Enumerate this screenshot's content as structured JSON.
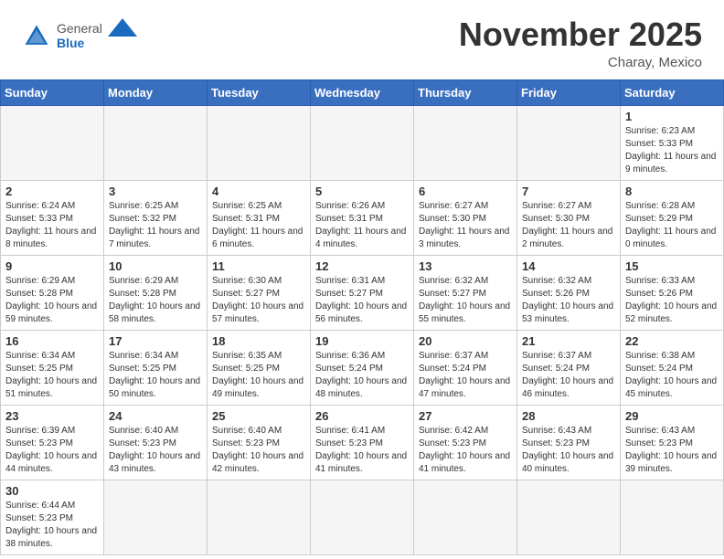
{
  "header": {
    "logo_general": "General",
    "logo_blue": "Blue",
    "month_title": "November 2025",
    "subtitle": "Charay, Mexico"
  },
  "weekdays": [
    "Sunday",
    "Monday",
    "Tuesday",
    "Wednesday",
    "Thursday",
    "Friday",
    "Saturday"
  ],
  "days": {
    "1": {
      "sunrise": "6:23 AM",
      "sunset": "5:33 PM",
      "daylight": "11 hours and 9 minutes."
    },
    "2": {
      "sunrise": "6:24 AM",
      "sunset": "5:33 PM",
      "daylight": "11 hours and 8 minutes."
    },
    "3": {
      "sunrise": "6:25 AM",
      "sunset": "5:32 PM",
      "daylight": "11 hours and 7 minutes."
    },
    "4": {
      "sunrise": "6:25 AM",
      "sunset": "5:31 PM",
      "daylight": "11 hours and 6 minutes."
    },
    "5": {
      "sunrise": "6:26 AM",
      "sunset": "5:31 PM",
      "daylight": "11 hours and 4 minutes."
    },
    "6": {
      "sunrise": "6:27 AM",
      "sunset": "5:30 PM",
      "daylight": "11 hours and 3 minutes."
    },
    "7": {
      "sunrise": "6:27 AM",
      "sunset": "5:30 PM",
      "daylight": "11 hours and 2 minutes."
    },
    "8": {
      "sunrise": "6:28 AM",
      "sunset": "5:29 PM",
      "daylight": "11 hours and 0 minutes."
    },
    "9": {
      "sunrise": "6:29 AM",
      "sunset": "5:28 PM",
      "daylight": "10 hours and 59 minutes."
    },
    "10": {
      "sunrise": "6:29 AM",
      "sunset": "5:28 PM",
      "daylight": "10 hours and 58 minutes."
    },
    "11": {
      "sunrise": "6:30 AM",
      "sunset": "5:27 PM",
      "daylight": "10 hours and 57 minutes."
    },
    "12": {
      "sunrise": "6:31 AM",
      "sunset": "5:27 PM",
      "daylight": "10 hours and 56 minutes."
    },
    "13": {
      "sunrise": "6:32 AM",
      "sunset": "5:27 PM",
      "daylight": "10 hours and 55 minutes."
    },
    "14": {
      "sunrise": "6:32 AM",
      "sunset": "5:26 PM",
      "daylight": "10 hours and 53 minutes."
    },
    "15": {
      "sunrise": "6:33 AM",
      "sunset": "5:26 PM",
      "daylight": "10 hours and 52 minutes."
    },
    "16": {
      "sunrise": "6:34 AM",
      "sunset": "5:25 PM",
      "daylight": "10 hours and 51 minutes."
    },
    "17": {
      "sunrise": "6:34 AM",
      "sunset": "5:25 PM",
      "daylight": "10 hours and 50 minutes."
    },
    "18": {
      "sunrise": "6:35 AM",
      "sunset": "5:25 PM",
      "daylight": "10 hours and 49 minutes."
    },
    "19": {
      "sunrise": "6:36 AM",
      "sunset": "5:24 PM",
      "daylight": "10 hours and 48 minutes."
    },
    "20": {
      "sunrise": "6:37 AM",
      "sunset": "5:24 PM",
      "daylight": "10 hours and 47 minutes."
    },
    "21": {
      "sunrise": "6:37 AM",
      "sunset": "5:24 PM",
      "daylight": "10 hours and 46 minutes."
    },
    "22": {
      "sunrise": "6:38 AM",
      "sunset": "5:24 PM",
      "daylight": "10 hours and 45 minutes."
    },
    "23": {
      "sunrise": "6:39 AM",
      "sunset": "5:23 PM",
      "daylight": "10 hours and 44 minutes."
    },
    "24": {
      "sunrise": "6:40 AM",
      "sunset": "5:23 PM",
      "daylight": "10 hours and 43 minutes."
    },
    "25": {
      "sunrise": "6:40 AM",
      "sunset": "5:23 PM",
      "daylight": "10 hours and 42 minutes."
    },
    "26": {
      "sunrise": "6:41 AM",
      "sunset": "5:23 PM",
      "daylight": "10 hours and 41 minutes."
    },
    "27": {
      "sunrise": "6:42 AM",
      "sunset": "5:23 PM",
      "daylight": "10 hours and 41 minutes."
    },
    "28": {
      "sunrise": "6:43 AM",
      "sunset": "5:23 PM",
      "daylight": "10 hours and 40 minutes."
    },
    "29": {
      "sunrise": "6:43 AM",
      "sunset": "5:23 PM",
      "daylight": "10 hours and 39 minutes."
    },
    "30": {
      "sunrise": "6:44 AM",
      "sunset": "5:23 PM",
      "daylight": "10 hours and 38 minutes."
    }
  }
}
